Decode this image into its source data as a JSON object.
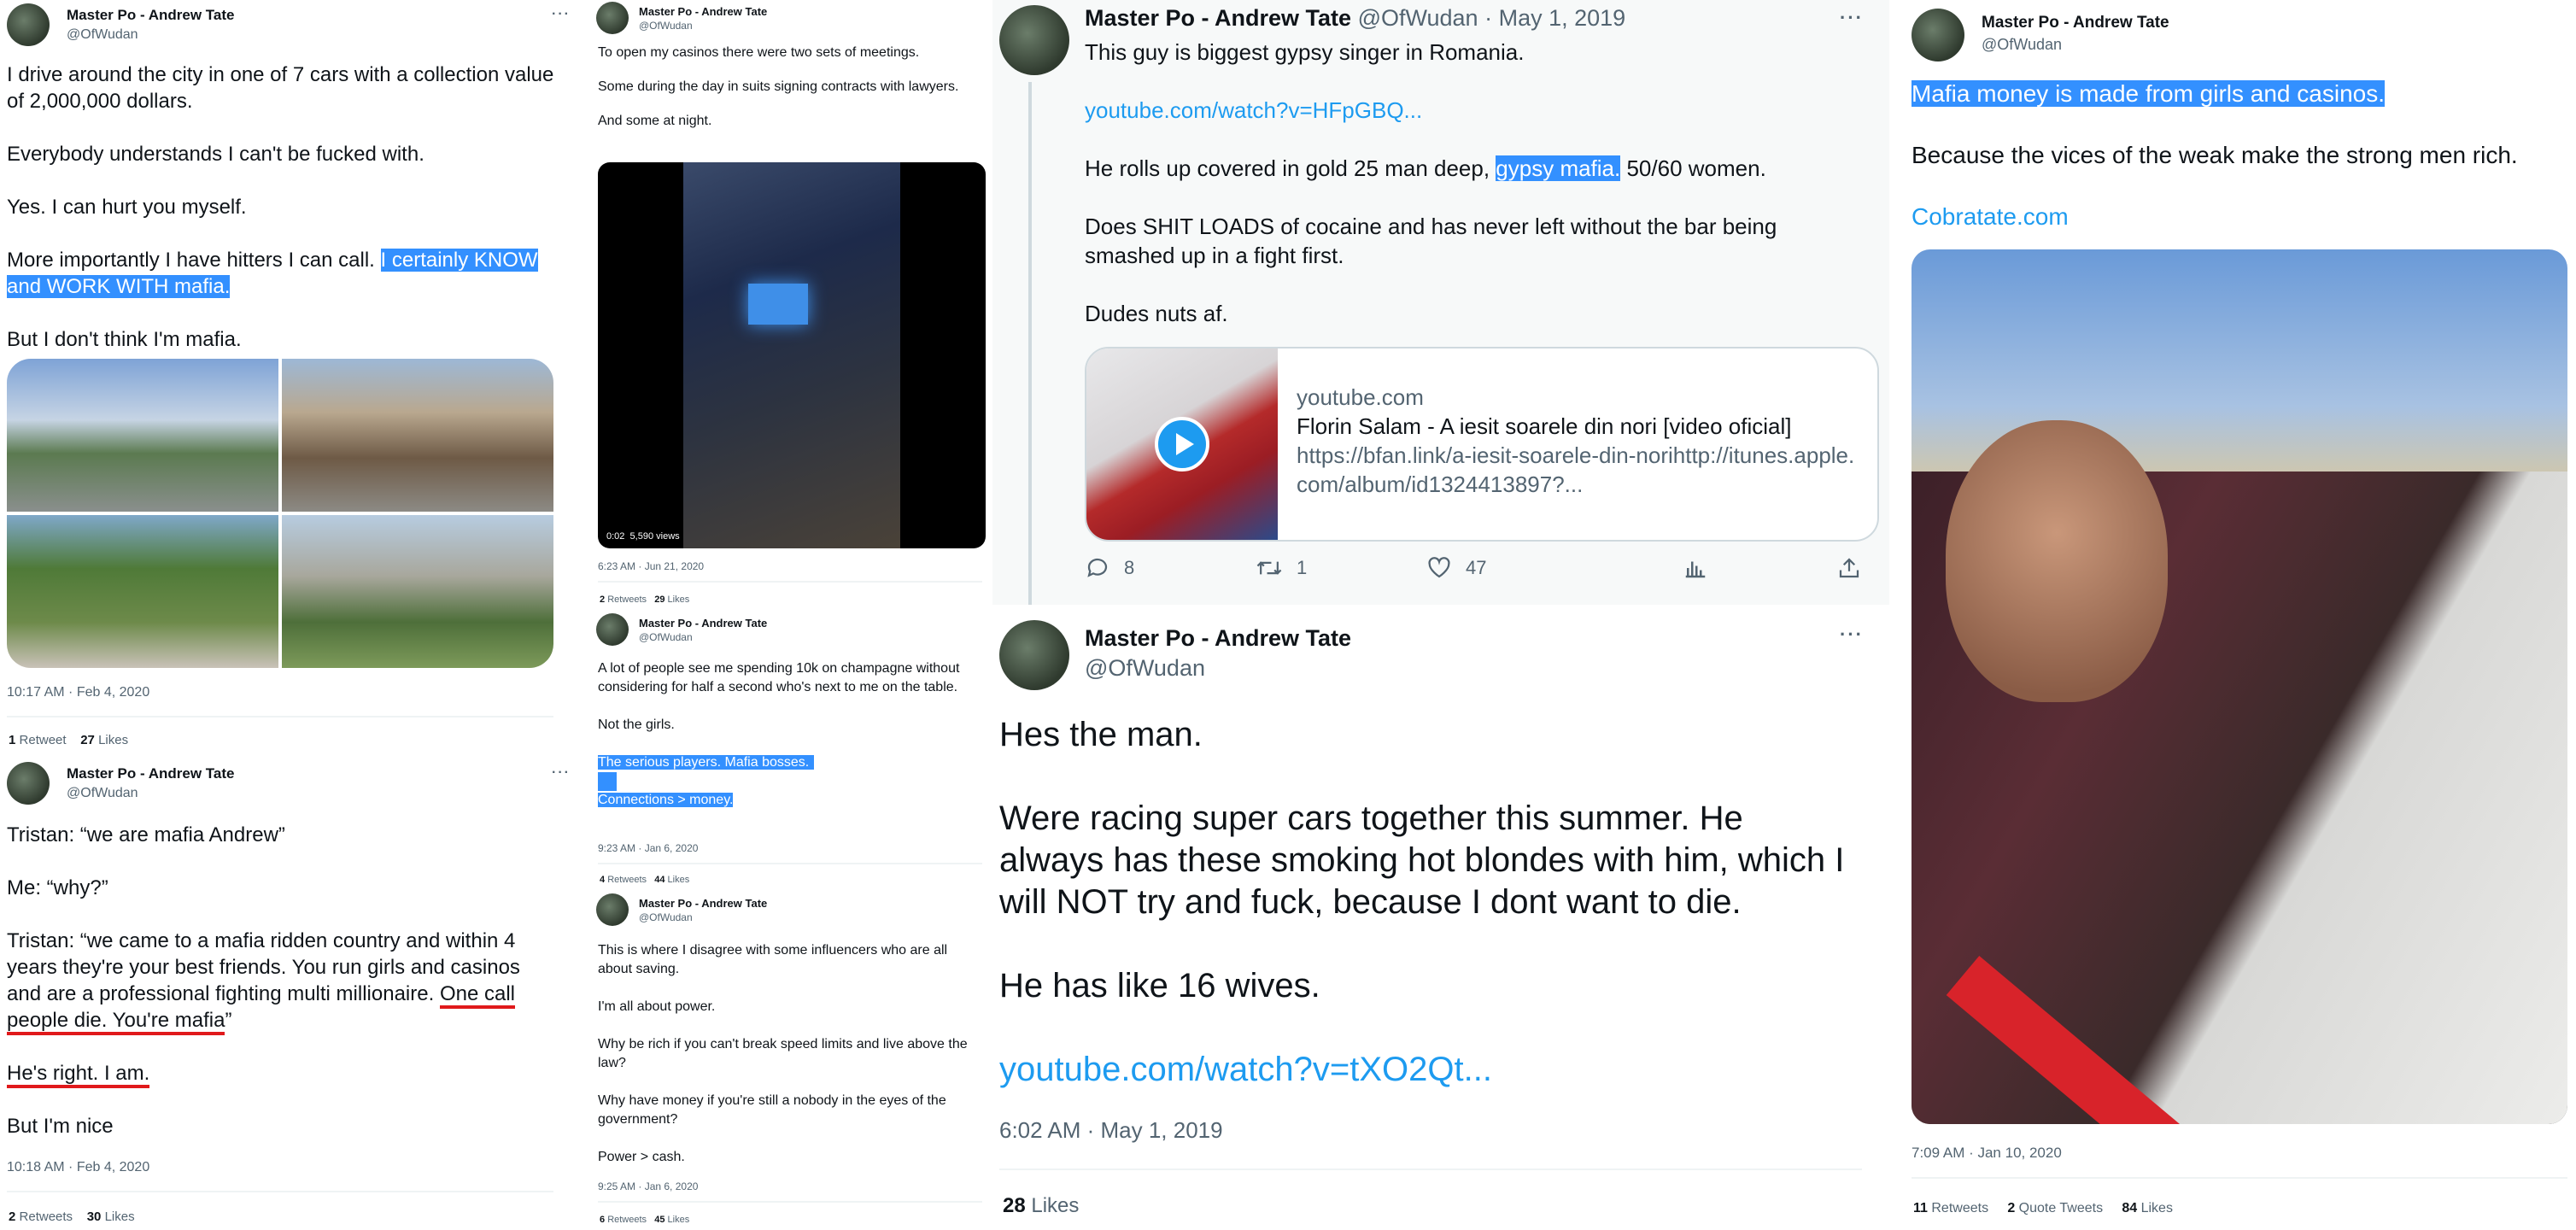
{
  "common": {
    "name": "Master Po - Andrew Tate",
    "handle": "@OfWudan",
    "more": "···"
  },
  "p1": {
    "text1": "I drive around the city in one of 7 cars with a collection value of 2,000,000 dollars.",
    "text2": "Everybody understands I can't be fucked with.",
    "text3": "Yes. I can hurt you myself.",
    "text4a": "More importantly I have hitters I can call. ",
    "text4b": "I certainly KNOW and WORK WITH mafia.",
    "text5": "But I don't think I'm mafia.",
    "time": "10:17 AM · Feb 4, 2020",
    "retweets_n": "1",
    "retweets_l": "Retweet",
    "likes_n": "27",
    "likes_l": "Likes"
  },
  "p2": {
    "text1": "Tristan: “we are mafia Andrew”",
    "text2": "Me: “why?”",
    "text3a": "Tristan: “we came to a mafia ridden country and within 4 years they're your best friends. You run girls and casinos and are a professional fighting multi millionaire. ",
    "text3b": "One call people die. You're mafia",
    "text3c": "”",
    "text4": "He's right. I am.",
    "text5": "But I'm nice",
    "time": "10:18 AM · Feb 4, 2020",
    "retweets_n": "2",
    "retweets_l": "Retweets",
    "likes_n": "30",
    "likes_l": "Likes"
  },
  "p3": {
    "text1": "To open my casinos there were two sets of meetings.",
    "text2": "Some during the day in suits signing contracts with lawyers.",
    "text3": "And some at night.",
    "video_time": "0:02",
    "video_views": "5,590 views",
    "time": "6:23 AM · Jun 21, 2020",
    "retweets_n": "2",
    "retweets_l": "Retweets",
    "likes_n": "29",
    "likes_l": "Likes"
  },
  "p4": {
    "text1": "A lot of people see me spending 10k on champagne without considering for half a second who's next to me on the table.",
    "text2": "Not the girls.",
    "text3": "The serious players. Mafia bosses.",
    "text4": "Connections > money.",
    "time": "9:23 AM · Jan 6, 2020",
    "retweets_n": "4",
    "retweets_l": "Retweets",
    "likes_n": "44",
    "likes_l": "Likes"
  },
  "p5": {
    "text1": "This is where I disagree with some influencers who are all about saving.",
    "text2": "I'm all about power.",
    "text3": "Why be rich if you can't break speed limits and live above the law?",
    "text4": "Why have money if you're still a nobody in the eyes of the government?",
    "text5": "Power > cash.",
    "time": "9:25 AM · Jan 6, 2020",
    "retweets_n": "6",
    "retweets_l": "Retweets",
    "likes_n": "45",
    "likes_l": "Likes"
  },
  "p6": {
    "date": "May 1, 2019",
    "text1": "This guy is biggest gypsy singer in Romania.",
    "link1": "youtube.com/watch?v=HFpGBQ...",
    "text2a": "He rolls up covered in gold 25 man deep, ",
    "text2b": "gypsy mafia.",
    "text2c": " 50/60 women.",
    "text3": "Does SHIT LOADS of cocaine and has never left without the bar being smashed up in a fight first.",
    "text4": "Dudes nuts af.",
    "card_domain": "youtube.com",
    "card_title": "Florin Salam - A iesit soarele din nori [video oficial]",
    "card_desc": "https://bfan.link/a-iesit-soarele-din-norihttp://itunes.apple.com/album/id1324413897?...",
    "replies": "8",
    "retweets": "1",
    "likes": "47"
  },
  "p7": {
    "text1": "Hes the man.",
    "text2": "Were racing super cars together this summer. He always has these smoking hot blondes with him, which I will NOT try and fuck, because I dont want to die.",
    "text3": "He has like 16 wives.",
    "link": "youtube.com/watch?v=tXO2Qt...",
    "time": "6:02 AM · May 1, 2019",
    "likes_n": "28",
    "likes_l": "Likes"
  },
  "p8": {
    "text1": "Mafia money is made from girls and casinos.",
    "text2": "Because the vices of the weak make the strong men rich.",
    "link": "Cobratate.com",
    "time": "7:09 AM · Jan 10, 2020",
    "retweets_n": "11",
    "retweets_l": "Retweets",
    "quotes_n": "2",
    "quotes_l": "Quote Tweets",
    "likes_n": "84",
    "likes_l": "Likes"
  },
  "icons": {
    "reply": "reply-icon",
    "retweet": "retweet-icon",
    "like": "heart-icon",
    "stats": "analytics-icon",
    "share": "share-icon",
    "play": "play-icon",
    "more": "more-icon"
  },
  "colors": {
    "link": "#1d9bf0",
    "highlight": "#3390ff",
    "underline": "#e0191b",
    "muted": "#536471",
    "border": "#cfd9de"
  }
}
